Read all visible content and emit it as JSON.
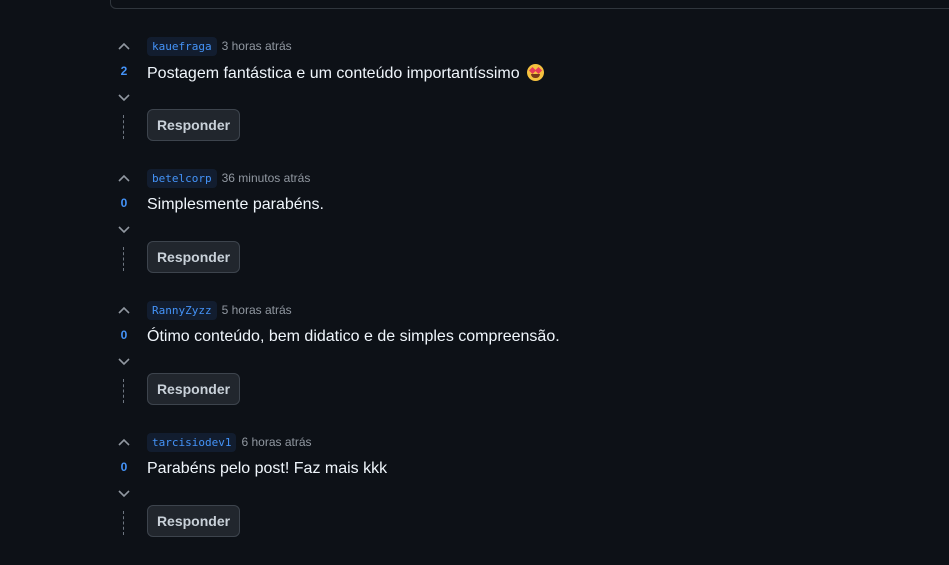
{
  "comments": [
    {
      "username": "kauefraga",
      "time": "3 horas atrás",
      "votes": "2",
      "text": "Postagem fantástica e um conteúdo importantíssimo",
      "emoji": "star-struck-emoji",
      "reply_label": "Responder"
    },
    {
      "username": "betelcorp",
      "time": "36 minutos atrás",
      "votes": "0",
      "text": "Simplesmente parabéns.",
      "reply_label": "Responder"
    },
    {
      "username": "RannyZyzz",
      "time": "5 horas atrás",
      "votes": "0",
      "text": "Ótimo conteúdo, bem didatico e de simples compreensão.",
      "reply_label": "Responder"
    },
    {
      "username": "tarcisiodev1",
      "time": "6 horas atrás",
      "votes": "0",
      "text": "Parabéns pelo post! Faz mais kkk",
      "reply_label": "Responder"
    }
  ],
  "icons": {
    "upvote": "chevron-up-icon",
    "downvote": "chevron-down-icon"
  },
  "colors": {
    "background": "#0d1117",
    "accent": "#4493f8",
    "text": "#f0f6fc",
    "muted": "#9198a1",
    "button_bg": "#21262d"
  }
}
